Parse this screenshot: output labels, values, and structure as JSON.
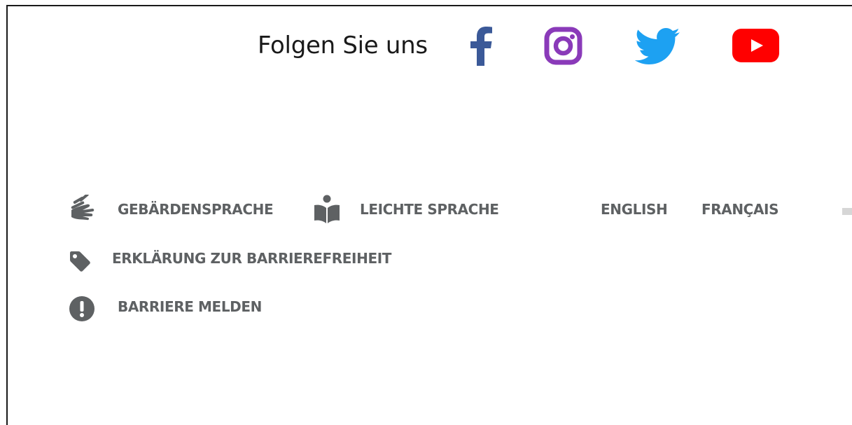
{
  "social": {
    "title": "Folgen Sie uns",
    "icons": [
      "facebook-icon",
      "instagram-icon",
      "twitter-icon",
      "youtube-icon"
    ],
    "colors": {
      "facebook": "#3b5998",
      "instagram": "#8a3ab9",
      "twitter": "#1da1f2",
      "youtube": "#ff0000"
    }
  },
  "accessibility": {
    "sign_language": "GEBÄRDENSPRACHE",
    "easy_language": "LEICHTE SPRACHE",
    "statement": "ERKLÄRUNG ZUR BARRIEREFREIHEIT",
    "report": "BARRIERE MELDEN"
  },
  "languages": {
    "english": "ENGLISH",
    "french": "FRANÇAIS"
  },
  "colors": {
    "link_text": "#5e6163",
    "icon_gray": "#5e6163",
    "title_text": "#1a1a1a"
  }
}
